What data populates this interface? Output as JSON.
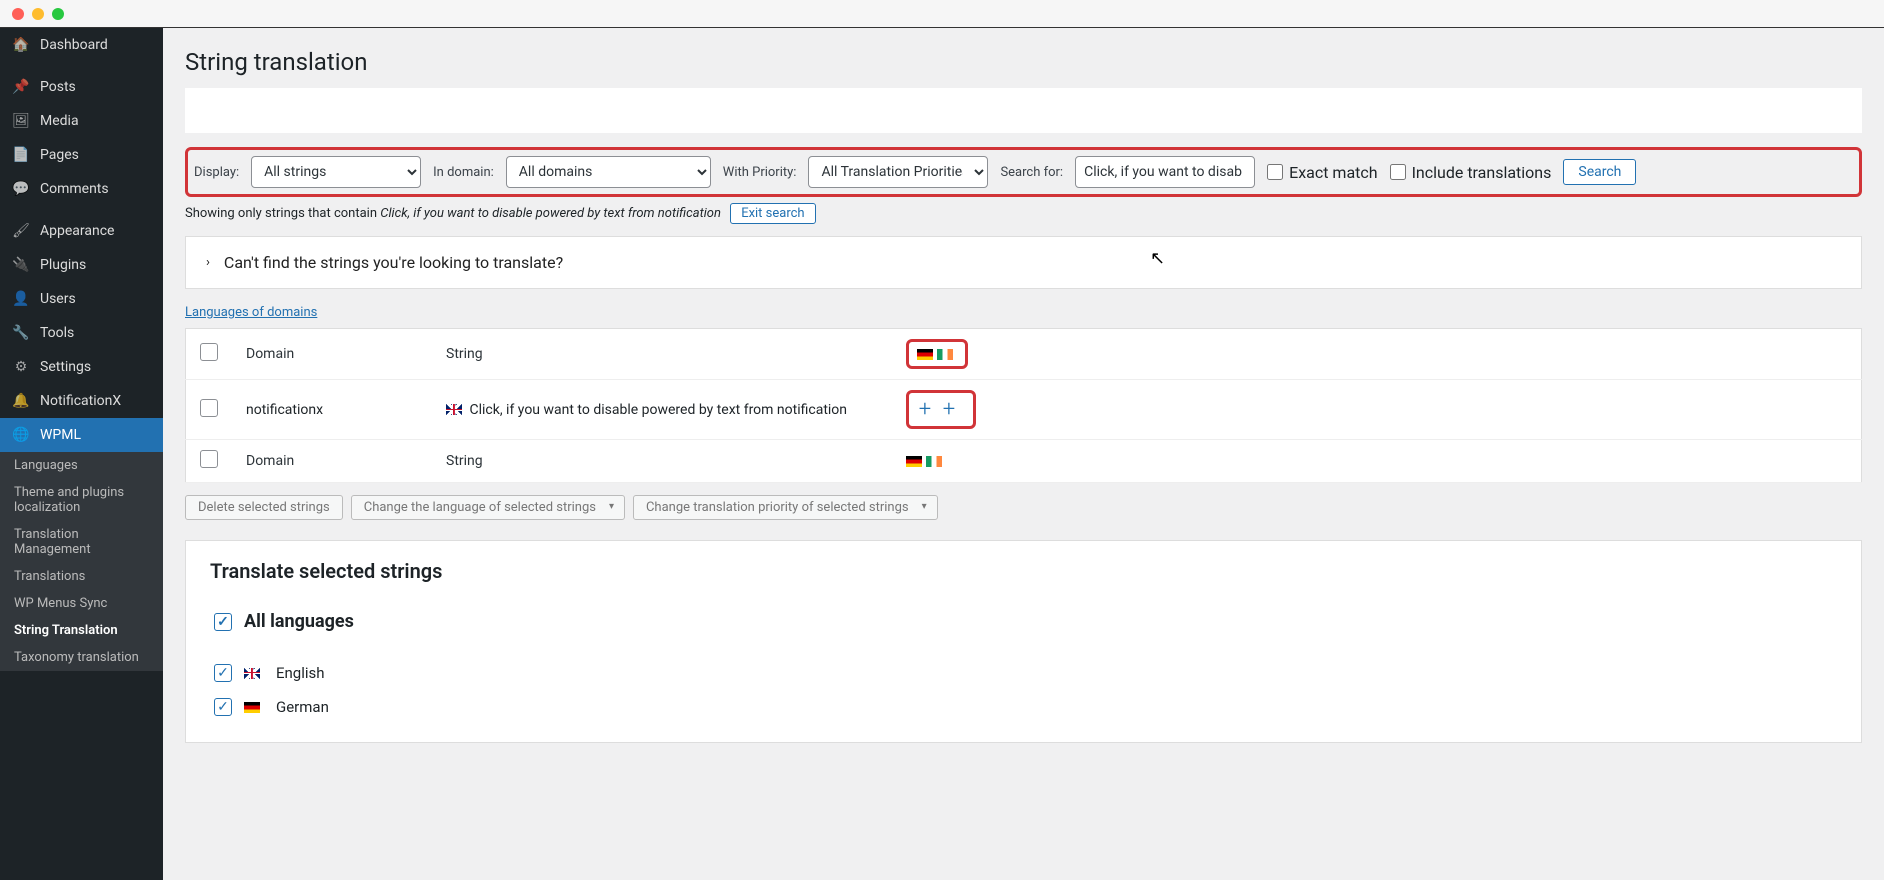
{
  "sidebar": {
    "items": [
      {
        "icon": "🏠",
        "label": "Dashboard"
      },
      {
        "icon": "📌",
        "label": "Posts"
      },
      {
        "icon": "🖼",
        "label": "Media"
      },
      {
        "icon": "📄",
        "label": "Pages"
      },
      {
        "icon": "💬",
        "label": "Comments"
      },
      {
        "icon": "🖌",
        "label": "Appearance"
      },
      {
        "icon": "🔌",
        "label": "Plugins"
      },
      {
        "icon": "👤",
        "label": "Users"
      },
      {
        "icon": "🔧",
        "label": "Tools"
      },
      {
        "icon": "⚙",
        "label": "Settings"
      },
      {
        "icon": "🔔",
        "label": "NotificationX"
      },
      {
        "icon": "🌐",
        "label": "WPML"
      }
    ],
    "sub": [
      "Languages",
      "Theme and plugins localization",
      "Translation Management",
      "Translations",
      "WP Menus Sync",
      "String Translation",
      "Taxonomy translation"
    ]
  },
  "page": {
    "title": "String translation",
    "filters": {
      "display_label": "Display:",
      "display_value": "All strings",
      "domain_label": "In domain:",
      "domain_value": "All domains",
      "priority_label": "With Priority:",
      "priority_value": "All Translation Priorities",
      "search_label": "Search for:",
      "search_value": "Click, if you want to disab",
      "exact_match": "Exact match",
      "include_translations": "Include translations",
      "search_btn": "Search"
    },
    "result_text": "Showing only strings that contain ",
    "result_query": "Click, if you want to disable powered by text from notification",
    "exit_search": "Exit search",
    "expand_text": "Can't find the strings you're looking to translate?",
    "lang_link": "Languages of domains",
    "table": {
      "h_domain": "Domain",
      "h_string": "String",
      "row_domain": "notificationx",
      "row_string": "Click, if you want to disable powered by text from notification"
    },
    "actions": {
      "delete": "Delete selected strings",
      "change_lang": "Change the language of selected strings",
      "change_prio": "Change translation priority of selected strings"
    },
    "translate_panel": {
      "title": "Translate selected strings",
      "all": "All languages",
      "langs": [
        "English",
        "German"
      ]
    }
  }
}
